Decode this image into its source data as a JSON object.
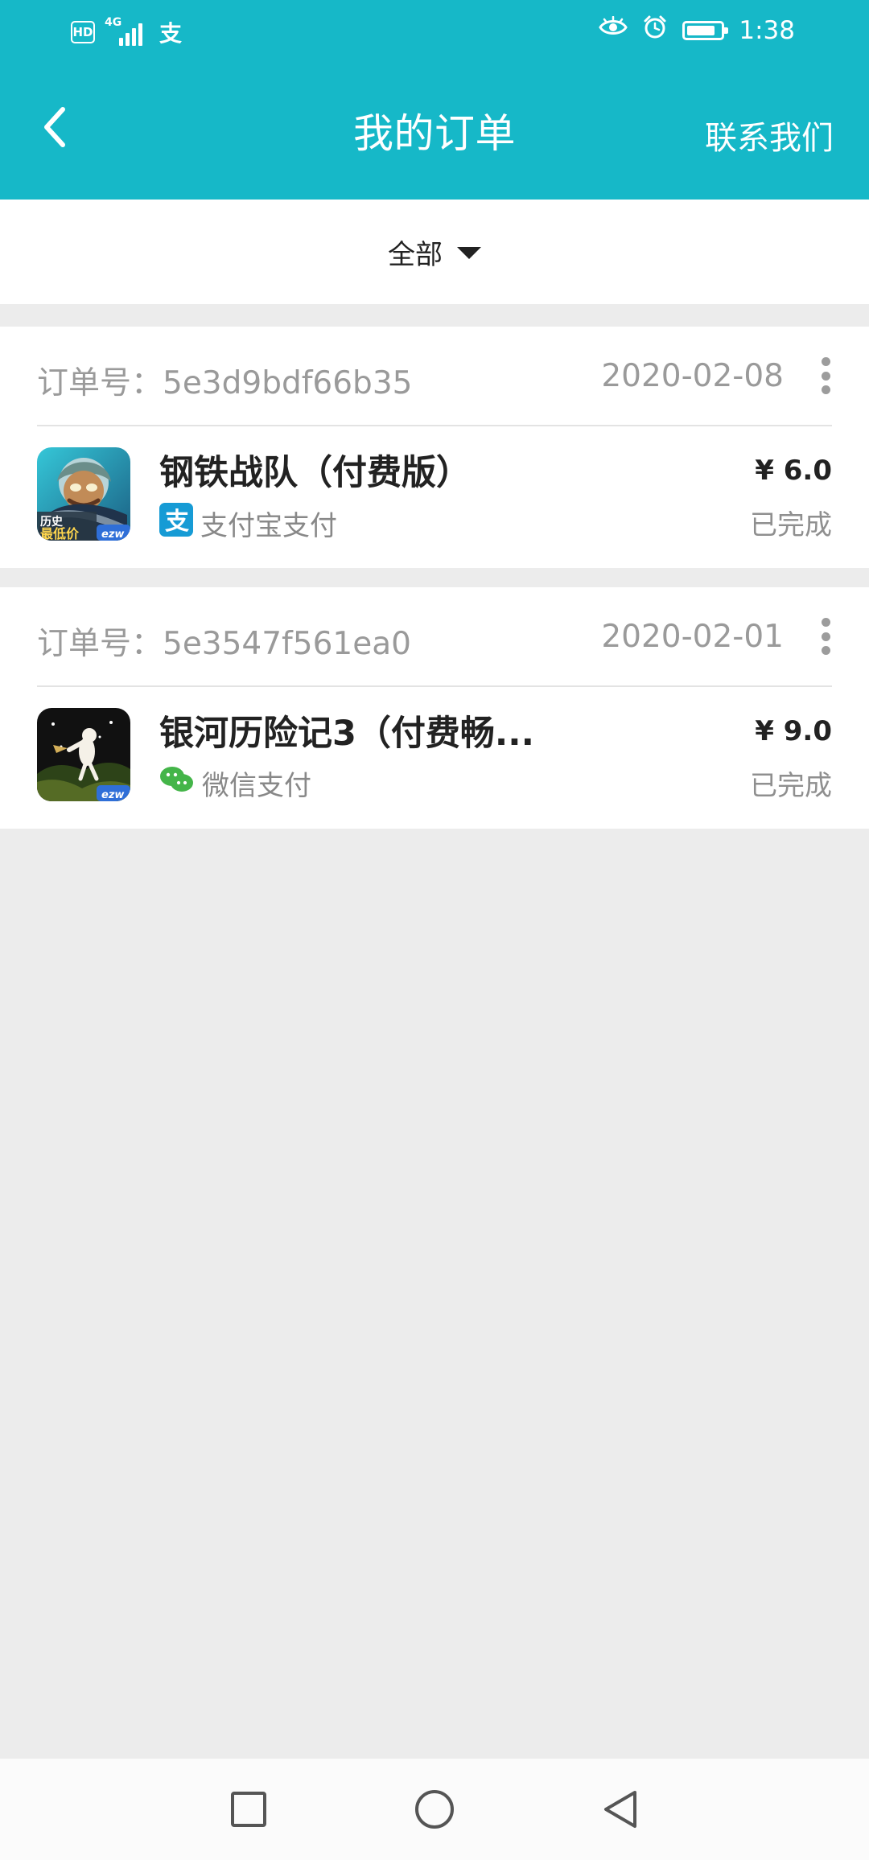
{
  "status_bar": {
    "hd_label": "HD",
    "network_label": "4G",
    "notification_glyph": "支",
    "time": "1:38"
  },
  "header": {
    "title": "我的订单",
    "contact_label": "联系我们"
  },
  "filter": {
    "selected": "全部"
  },
  "orders": [
    {
      "order_label": "订单号：5e3d9bdf66b35",
      "date": "2020-02-08",
      "app_name": "钢铁战队（付费版）",
      "payment_method": "支付宝支付",
      "payment_icon": "alipay-icon",
      "price": "¥ 6.0",
      "status": "已完成",
      "icon_text": {
        "line1": "历史",
        "line2": "最低价",
        "tag": "ezw"
      }
    },
    {
      "order_label": "订单号：5e3547f561ea0",
      "date": "2020-02-01",
      "app_name": "银河历险记3（付费畅...",
      "payment_method": "微信支付",
      "payment_icon": "wechat-pay-icon",
      "price": "¥ 9.0",
      "status": "已完成",
      "icon_text": {
        "tag": "ezw"
      }
    }
  ],
  "colors": {
    "accent": "#16b8c8",
    "page_bg": "#ececec",
    "card_bg": "#ffffff",
    "alipay": "#169bd5",
    "wechat": "#44b549"
  }
}
